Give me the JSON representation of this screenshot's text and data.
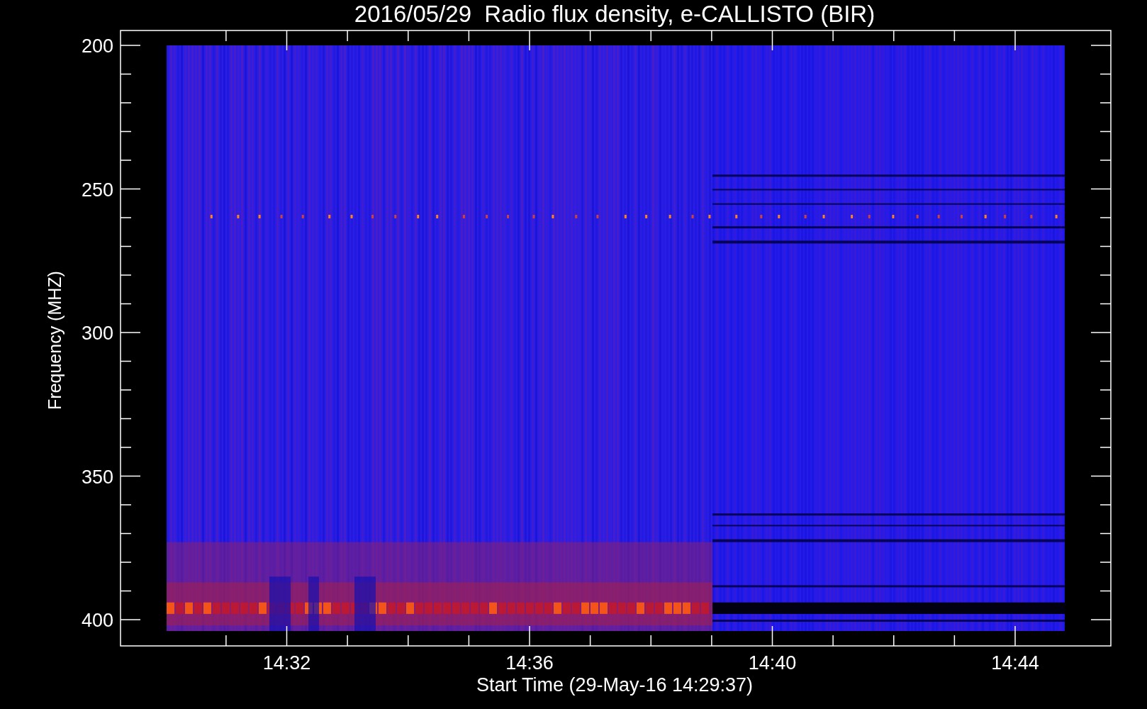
{
  "title": "2016/05/29  Radio flux density, e-CALLISTO (BIR)",
  "y_axis": {
    "label": "Frequency (MHZ)",
    "ticks": [
      "200",
      "250",
      "300",
      "350",
      "400"
    ]
  },
  "x_axis": {
    "label": "Start Time (29-May-16 14:29:37)",
    "ticks": [
      "14:32",
      "14:36",
      "14:40",
      "14:44"
    ]
  }
}
